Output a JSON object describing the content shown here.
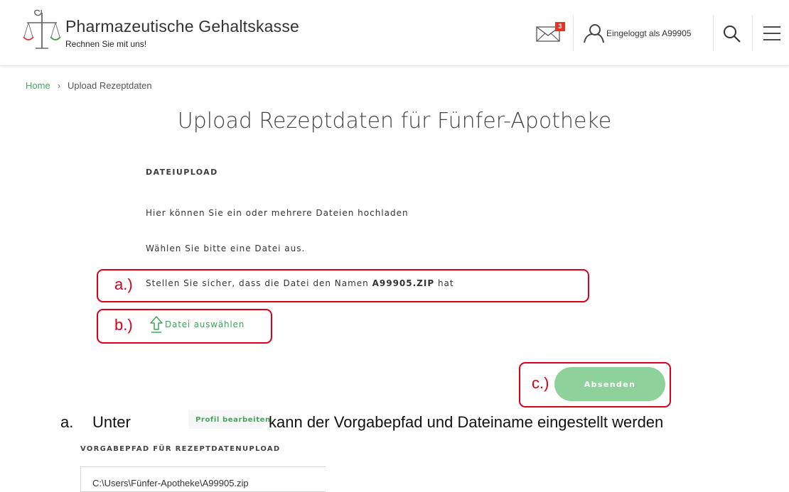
{
  "header": {
    "brand_title": "Pharmazeutische Gehaltskasse",
    "brand_subtitle": "Rechnen Sie mit uns!",
    "mail_count": "3",
    "user_prefix": "Eingeloggt als ",
    "user_id": "A99905",
    "icons": [
      "scales-logo-icon",
      "mail-icon",
      "user-icon",
      "search-icon",
      "menu-icon"
    ]
  },
  "breadcrumb": {
    "home": "Home",
    "separator": "›",
    "current": "Upload Rezeptdaten"
  },
  "page_title": "Upload Rezeptdaten für Fünfer-Apotheke",
  "upload": {
    "section_heading": "DATEIUPLOAD",
    "line1": "Hier können Sie ein oder mehrere Dateien hochladen",
    "line2": "Wählen Sie bitte eine Datei aus.",
    "line3_prefix": "Stellen Sie sicher, dass die Datei den Namen ",
    "line3_filename": "A99905.ZIP",
    "line3_suffix": " hat",
    "choose_file_label": "Datei auswählen",
    "submit_label": "Absenden"
  },
  "annotations": {
    "a": "a.)",
    "b": "b.)",
    "c": "c.)",
    "color": "#d9001b"
  },
  "instructions": {
    "marker": "a.",
    "text_before": "Unter",
    "badge_label": "Profil bearbeiten",
    "text_after": "kann der Vorgabepfad und Dateiname eingestellt werden"
  },
  "settings": {
    "heading": "VORGABEPFAD FÜR REZEPTDATENUPLOAD",
    "path_value": "C:\\Users\\Fünfer-Apotheke\\A99905.zip"
  },
  "colors": {
    "accent_green": "#3aa557",
    "button_green": "#8fd19a",
    "badge_red": "#e5332a"
  }
}
